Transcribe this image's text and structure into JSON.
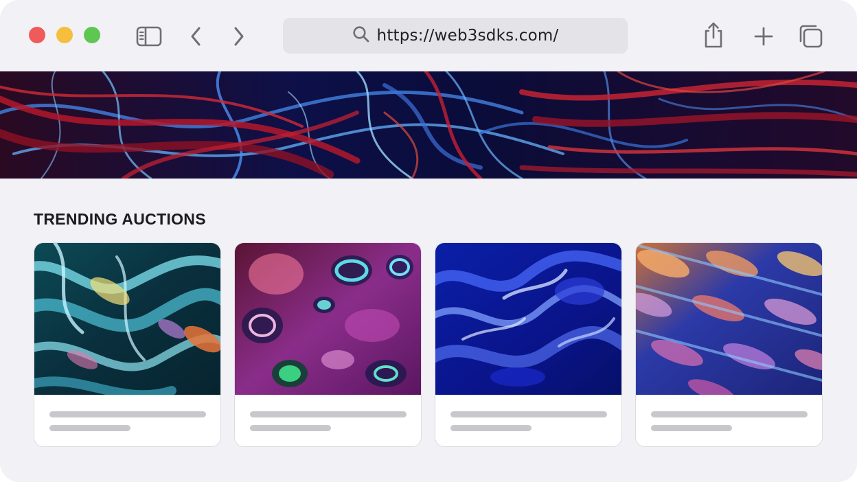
{
  "browser": {
    "url": "https://web3sdks.com/",
    "icons": {
      "sidebar": "sidebar-toggle-icon",
      "back": "chevron-left-icon",
      "forward": "chevron-right-icon",
      "search": "search-icon",
      "share": "share-icon",
      "new_tab": "plus-icon",
      "tabs": "tab-overview-icon"
    },
    "traffic_light_colors": {
      "close": "#ee5b58",
      "minimize": "#f5be3d",
      "zoom": "#5fc653"
    }
  },
  "page": {
    "section_title": "TRENDING AUCTIONS",
    "cards": [
      {
        "artwork": "teal-chrome-waves"
      },
      {
        "artwork": "magenta-liquid-cells"
      },
      {
        "artwork": "blue-glass-ripples"
      },
      {
        "artwork": "iridescent-lattice"
      }
    ]
  }
}
